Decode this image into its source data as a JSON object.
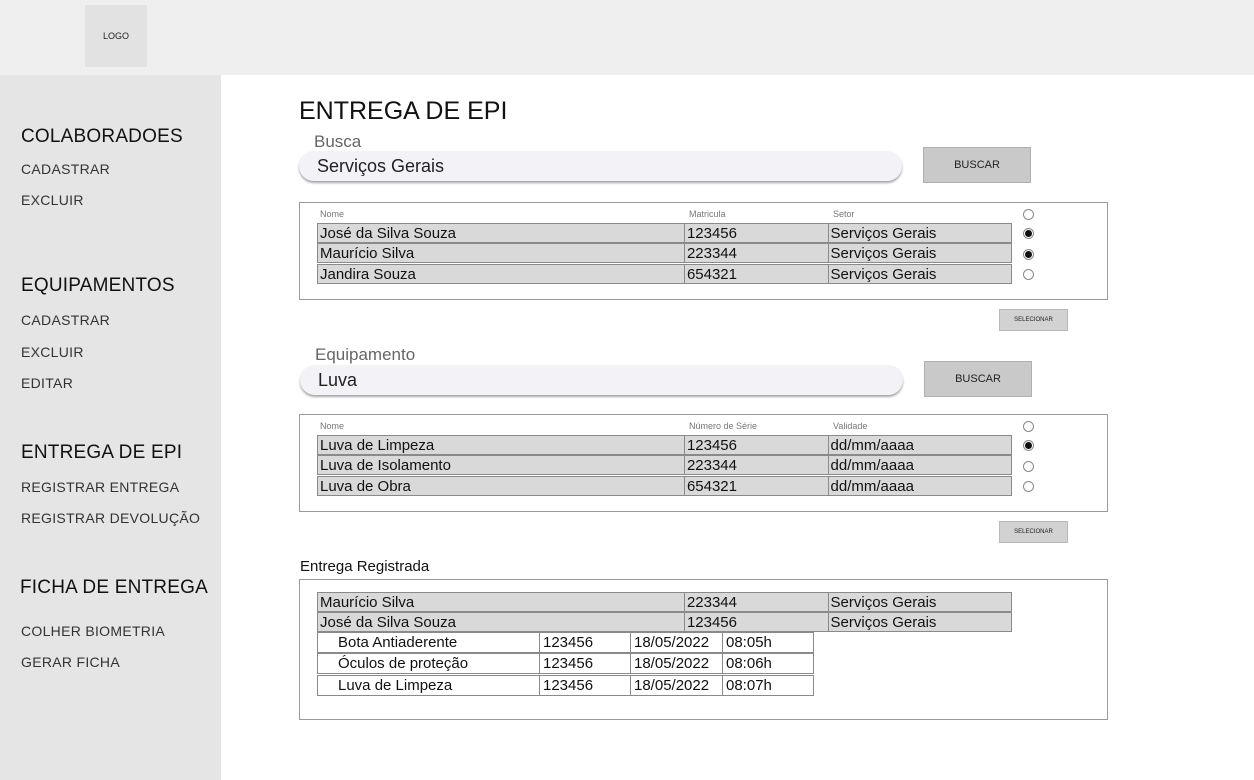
{
  "header": {
    "logo": "LOGO"
  },
  "sidebar": {
    "sections": [
      {
        "title": "COLABORADOES",
        "items": [
          "CADASTRAR",
          "EXCLUIR"
        ]
      },
      {
        "title": "EQUIPAMENTOS",
        "items": [
          "CADASTRAR",
          "EXCLUIR",
          "EDITAR"
        ]
      },
      {
        "title": "ENTREGA DE EPI",
        "items": [
          "REGISTRAR ENTREGA",
          "REGISTRAR DEVOLUÇÃO"
        ]
      },
      {
        "title": "FICHA DE ENTREGA",
        "items": [
          "COLHER BIOMETRIA",
          "GERAR FICHA"
        ]
      }
    ]
  },
  "main": {
    "title": "ENTREGA DE EPI",
    "busca": {
      "label": "Busca",
      "value": "Serviços Gerais",
      "button": "BUSCAR",
      "headers": [
        "Nome",
        "Matricula",
        "Setor"
      ],
      "header_radio_selected": false,
      "rows": [
        {
          "nome": "José da Silva Souza",
          "matricula": "123456",
          "setor": "Serviços Gerais",
          "selected": true
        },
        {
          "nome": "Maurício Silva",
          "matricula": "223344",
          "setor": "Serviços Gerais",
          "selected": true
        },
        {
          "nome": "Jandira Souza",
          "matricula": "654321",
          "setor": "Serviços Gerais",
          "selected": false
        }
      ],
      "select_button": "SELECIONAR"
    },
    "equipamento": {
      "label": "Equipamento",
      "value": "Luva",
      "button": "BUSCAR",
      "headers": [
        "Nome",
        "Número de Série",
        "Validade"
      ],
      "header_radio_selected": false,
      "rows": [
        {
          "nome": "Luva de Limpeza",
          "serie": "123456",
          "validade": "dd/mm/aaaa",
          "selected": true
        },
        {
          "nome": "Luva de Isolamento",
          "serie": "223344",
          "validade": "dd/mm/aaaa",
          "selected": false
        },
        {
          "nome": "Luva de Obra",
          "serie": "654321",
          "validade": "dd/mm/aaaa",
          "selected": false
        }
      ],
      "select_button": "SELECIONAR"
    },
    "entrega": {
      "label": "Entrega Registrada",
      "colaboradores": [
        {
          "nome": "Maurício Silva",
          "matricula": "223344",
          "setor": "Serviços Gerais"
        },
        {
          "nome": "José da Silva Souza",
          "matricula": "123456",
          "setor": "Serviços Gerais"
        }
      ],
      "itens": [
        {
          "nome": "Bota Antiaderente",
          "serie": "123456",
          "data": "18/05/2022",
          "hora": "08:05h"
        },
        {
          "nome": "Óculos de proteção",
          "serie": "123456",
          "data": "18/05/2022",
          "hora": "08:06h"
        },
        {
          "nome": "Luva de Limpeza",
          "serie": "123456",
          "data": "18/05/2022",
          "hora": "08:07h"
        }
      ]
    }
  }
}
